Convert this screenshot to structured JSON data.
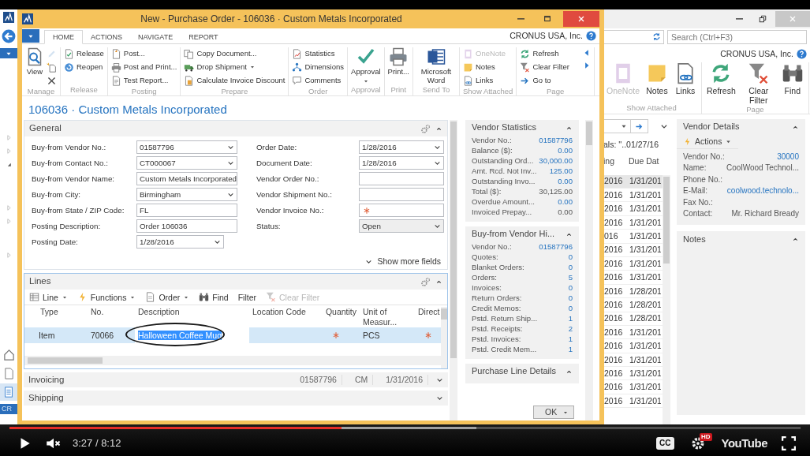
{
  "video": {
    "paused": true,
    "muted": true,
    "time": "3:27 / 8:12",
    "progress": {
      "level": 0.42
    },
    "buffered": {
      "level": 0.59
    },
    "captions": "CC",
    "hd_badge": "HD",
    "logo": "YouTube"
  },
  "back_window": {
    "nav": {
      "toggles": [
        {
          "expanded": false
        },
        {
          "expanded": false
        },
        {
          "expanded": true
        },
        {
          "expanded": false
        },
        {
          "expanded": false
        },
        {
          "expanded": false
        }
      ],
      "status": "CR"
    },
    "search": {
      "placeholder": "Search (Ctrl+F3)"
    },
    "company": "CRONUS USA, Inc.",
    "ribbon": {
      "groups": [
        {
          "label": "Show Attached",
          "actions": [
            {
              "label": "OneNote",
              "disabled": true
            },
            {
              "label": "Notes",
              "disabled": false
            },
            {
              "label": "Links",
              "disabled": false
            }
          ]
        },
        {
          "label": "Page",
          "actions": [
            {
              "label": "Refresh",
              "disabled": false
            },
            {
              "label": "Clear Filter",
              "disabled": false
            },
            {
              "label": "Find",
              "disabled": false
            }
          ]
        }
      ]
    },
    "filter_text": "als: ''..01/27/16",
    "list": {
      "columns": [
        "ing",
        "Due Dat"
      ],
      "rows": [
        {
          "cells": [
            "2016",
            "1/31/201"
          ],
          "selected": true
        },
        {
          "cells": [
            "2016",
            "1/31/201"
          ],
          "selected": false
        },
        {
          "cells": [
            "2016",
            "1/31/201"
          ],
          "selected": false
        },
        {
          "cells": [
            "2016",
            "1/31/201"
          ],
          "selected": false
        },
        {
          "cells": [
            "016",
            "1/31/201"
          ],
          "selected": false
        },
        {
          "cells": [
            "2016",
            "1/31/201"
          ],
          "selected": false
        },
        {
          "cells": [
            "2016",
            "1/31/201"
          ],
          "selected": false
        },
        {
          "cells": [
            "2016",
            "1/31/201"
          ],
          "selected": false
        },
        {
          "cells": [
            "2016",
            "1/28/201"
          ],
          "selected": false
        },
        {
          "cells": [
            "2016",
            "1/28/201"
          ],
          "selected": false
        },
        {
          "cells": [
            "2016",
            "1/28/201"
          ],
          "selected": false
        },
        {
          "cells": [
            "2016",
            "1/31/201"
          ],
          "selected": false
        },
        {
          "cells": [
            "2016",
            "1/31/201"
          ],
          "selected": false
        },
        {
          "cells": [
            "2016",
            "1/31/201"
          ],
          "selected": false
        },
        {
          "cells": [
            "2016",
            "1/31/201"
          ],
          "selected": false
        },
        {
          "cells": [
            "2016",
            "1/31/201"
          ],
          "selected": false
        },
        {
          "cells": [
            "2016",
            "1/31/201"
          ],
          "selected": false
        }
      ]
    },
    "vendor_details": {
      "title": "Vendor Details",
      "actions": "Actions",
      "fields": [
        {
          "label": "Vendor No.:",
          "value": "30000",
          "link": true
        },
        {
          "label": "Name:",
          "value": "CoolWood Technol...",
          "link": false
        },
        {
          "label": "Phone No.:"
        },
        {
          "label": "E-Mail:",
          "value": "coolwood.technolo...",
          "link": true
        },
        {
          "label": "Fax No.:"
        },
        {
          "label": "Contact:",
          "value": "Mr. Richard Bready",
          "link": false
        }
      ]
    },
    "notes": {
      "title": "Notes"
    }
  },
  "window": {
    "title": "New - Purchase Order - 106036 · Custom Metals Incorporated",
    "tabs": [
      {
        "label": "HOME",
        "selected": true
      },
      {
        "label": "ACTIONS",
        "selected": false
      },
      {
        "label": "NAVIGATE",
        "selected": false
      },
      {
        "label": "REPORT",
        "selected": false
      }
    ],
    "company": "CRONUS USA, Inc.",
    "ribbon": {
      "groups": [
        {
          "label": "Manage",
          "actions": [
            {
              "kind": "large",
              "label": "View",
              "disabled": false,
              "dropdown": false
            },
            {
              "kind": "icon",
              "disabled": true,
              "dropdown": false
            },
            {
              "kind": "icon",
              "disabled": false,
              "dropdown": false
            },
            {
              "kind": "icon",
              "disabled": false,
              "dropdown": false
            }
          ]
        },
        {
          "label": "Release",
          "actions": [
            {
              "kind": "small",
              "label": "Release",
              "disabled": false,
              "dropdown": false
            },
            {
              "kind": "small",
              "label": "Reopen",
              "disabled": false,
              "dropdown": false
            }
          ]
        },
        {
          "label": "Posting",
          "actions": [
            {
              "kind": "small",
              "label": "Post...",
              "disabled": false,
              "dropdown": false
            },
            {
              "kind": "small",
              "label": "Post and Print...",
              "disabled": false,
              "dropdown": false
            },
            {
              "kind": "small",
              "label": "Test Report...",
              "disabled": false,
              "dropdown": false
            }
          ]
        },
        {
          "label": "Prepare",
          "actions": [
            {
              "kind": "small",
              "label": "Copy Document...",
              "disabled": false,
              "dropdown": false
            },
            {
              "kind": "small",
              "label": "Drop Shipment",
              "disabled": false,
              "dropdown": true
            },
            {
              "kind": "small",
              "label": "Calculate Invoice Discount",
              "disabled": false,
              "dropdown": false
            }
          ]
        },
        {
          "label": "Order",
          "actions": [
            {
              "kind": "small",
              "label": "Statistics",
              "disabled": false,
              "dropdown": false
            },
            {
              "kind": "small",
              "label": "Dimensions",
              "disabled": false,
              "dropdown": false
            },
            {
              "kind": "small",
              "label": "Comments",
              "disabled": false,
              "dropdown": false
            }
          ]
        },
        {
          "label": "Approval",
          "actions": [
            {
              "kind": "large",
              "label": "Approval",
              "disabled": false,
              "dropdown": true
            }
          ]
        },
        {
          "label": "Print",
          "actions": [
            {
              "kind": "large",
              "label": "Print...",
              "disabled": false,
              "dropdown": false
            }
          ]
        },
        {
          "label": "Send To",
          "actions": [
            {
              "kind": "large",
              "label": "Microsoft Word",
              "disabled": false,
              "dropdown": false
            }
          ]
        },
        {
          "label": "Show Attached",
          "actions": [
            {
              "kind": "small",
              "label": "OneNote",
              "disabled": true,
              "dropdown": false
            },
            {
              "kind": "small",
              "label": "Notes",
              "disabled": false,
              "dropdown": false
            },
            {
              "kind": "small",
              "label": "Links",
              "disabled": false,
              "dropdown": false
            }
          ]
        },
        {
          "label": "Page",
          "actions": [
            {
              "kind": "small",
              "label": "Refresh",
              "disabled": false,
              "dropdown": false
            },
            {
              "kind": "small",
              "label": "Clear Filter",
              "disabled": false,
              "dropdown": false
            },
            {
              "kind": "small",
              "label": "Go to",
              "disabled": false,
              "dropdown": false
            }
          ]
        }
      ]
    },
    "page_title": "106036 · Custom Metals Incorporated",
    "general": {
      "title": "General",
      "show_more": "Show more fields",
      "left": [
        {
          "label": "Buy-from Vendor No.:",
          "value": "01587796",
          "kind": "dropdown",
          "disabled": false,
          "required": false
        },
        {
          "label": "Buy-from Contact No.:",
          "value": "CT000067",
          "kind": "dropdown",
          "disabled": false,
          "required": false
        },
        {
          "label": "Buy-from Vendor Name:",
          "value": "Custom Metals Incorporated",
          "kind": "text",
          "disabled": false,
          "required": false
        },
        {
          "label": "Buy-from City:",
          "value": "Birmingham",
          "kind": "dropdown",
          "disabled": false,
          "required": false
        },
        {
          "label": "Buy-from State / ZIP Code:",
          "value": "FL",
          "kind": "text",
          "disabled": false,
          "required": false
        },
        {
          "label": "Posting Description:",
          "value": "Order 106036",
          "kind": "text",
          "disabled": false,
          "required": false
        },
        {
          "label": "Posting Date:",
          "value": "1/28/2016",
          "kind": "date",
          "disabled": false,
          "required": false
        }
      ],
      "right": [
        {
          "label": "Order Date:",
          "value": "1/28/2016",
          "kind": "dropdown",
          "disabled": false,
          "required": false
        },
        {
          "label": "Document Date:",
          "value": "1/28/2016",
          "kind": "dropdown",
          "disabled": false,
          "required": false
        },
        {
          "label": "Vendor Order No.:",
          "kind": "text",
          "disabled": false,
          "required": false
        },
        {
          "label": "Vendor Shipment No.:",
          "kind": "text",
          "disabled": false,
          "required": false
        },
        {
          "label": "Vendor Invoice No.:",
          "kind": "text",
          "disabled": false,
          "required": true
        },
        {
          "label": "Status:",
          "value": "Open",
          "kind": "dropdown",
          "disabled": true,
          "required": false
        }
      ]
    },
    "lines": {
      "title": "Lines",
      "toolbar": [
        {
          "label": "Line",
          "dropdown": true,
          "disabled": false
        },
        {
          "label": "Functions",
          "dropdown": true,
          "disabled": false
        },
        {
          "label": "Order",
          "dropdown": true,
          "disabled": false
        },
        {
          "label": "Find",
          "dropdown": false,
          "disabled": false
        },
        {
          "label": "Filter",
          "dropdown": false,
          "disabled": false
        },
        {
          "label": "Clear Filter",
          "dropdown": false,
          "disabled": true
        }
      ],
      "columns": [
        "Type",
        "No.",
        "Description",
        "Location Code",
        "Quantity",
        "Unit of Measur...",
        "Direct"
      ],
      "circle_annotation": true,
      "rows": [
        {
          "selected": true,
          "cells": [
            {
              "value": "Item",
              "required": false,
              "editing": false
            },
            {
              "value": "70066",
              "required": false,
              "editing": false
            },
            {
              "value": "Halloween Coffee Mug",
              "required": false,
              "editing": true
            },
            {
              "required": false,
              "editing": false
            },
            {
              "required": true,
              "editing": false
            },
            {
              "value": "PCS",
              "required": false,
              "editing": false
            },
            {
              "required": true,
              "editing": false
            }
          ]
        }
      ]
    },
    "collapsed_tabs": [
      {
        "title": "Invoicing",
        "summary": [
          "01587796",
          "CM",
          "1/31/2016"
        ]
      },
      {
        "title": "Shipping"
      }
    ],
    "factboxes": [
      {
        "title": "Vendor Statistics",
        "rows": [
          {
            "label": "Vendor No.:",
            "value": "01587796",
            "link": true
          },
          {
            "label": "Balance ($):",
            "value": "0.00",
            "link": true
          },
          {
            "label": "Outstanding Ord...",
            "value": "30,000.00",
            "link": true
          },
          {
            "label": "Amt. Rcd. Not Inv...",
            "value": "125.00",
            "link": true
          },
          {
            "label": "Outstanding Invo...",
            "value": "0.00",
            "link": true
          },
          {
            "label": "Total ($):",
            "value": "30,125.00",
            "link": false
          },
          {
            "label": "Overdue Amount...",
            "value": "0.00",
            "link": true
          },
          {
            "label": "Invoiced Prepay...",
            "value": "0.00",
            "link": false
          }
        ]
      },
      {
        "title": "Buy-from Vendor Hi...",
        "rows": [
          {
            "label": "Vendor No.:",
            "value": "01587796",
            "link": true
          },
          {
            "label": "Quotes:",
            "value": "0",
            "link": true
          },
          {
            "label": "Blanket Orders:",
            "value": "0",
            "link": true
          },
          {
            "label": "Orders:",
            "value": "5",
            "link": true
          },
          {
            "label": "Invoices:",
            "value": "0",
            "link": true
          },
          {
            "label": "Return Orders:",
            "value": "0",
            "link": true
          },
          {
            "label": "Credit Memos:",
            "value": "0",
            "link": true
          },
          {
            "label": "Pstd. Return Ship...",
            "value": "1",
            "link": true
          },
          {
            "label": "Pstd. Receipts:",
            "value": "2",
            "link": true
          },
          {
            "label": "Pstd. Invoices:",
            "value": "1",
            "link": true
          },
          {
            "label": "Pstd. Credit Mem...",
            "value": "1",
            "link": true
          }
        ]
      },
      {
        "title": "Purchase Line Details"
      }
    ],
    "ok_button": "OK"
  }
}
